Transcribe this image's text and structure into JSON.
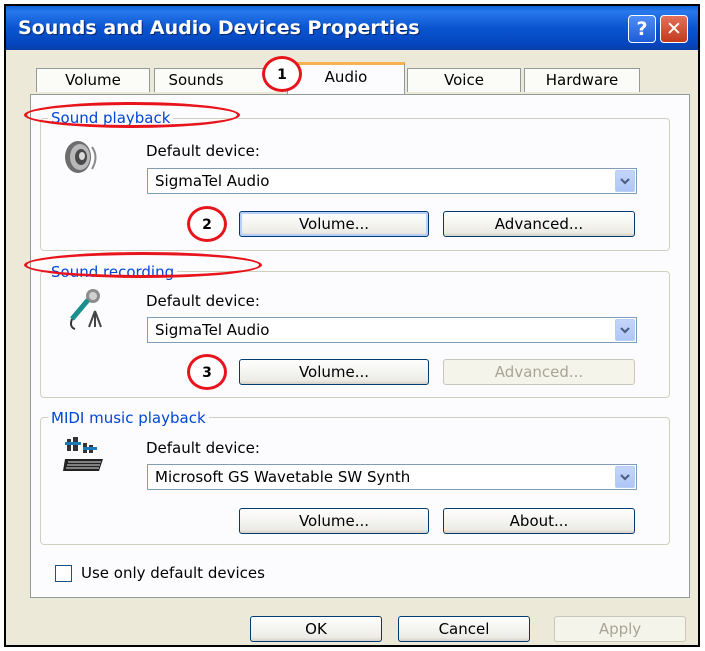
{
  "window": {
    "title": "Sounds and Audio Devices Properties",
    "help_glyph": "?",
    "close_glyph": "✕"
  },
  "tabs": [
    {
      "label": "Volume"
    },
    {
      "label": "Sounds"
    },
    {
      "label": "Audio",
      "active": true
    },
    {
      "label": "Voice"
    },
    {
      "label": "Hardware"
    }
  ],
  "sound_playback": {
    "title": "Sound playback",
    "default_label": "Default device:",
    "device": "SigmaTel Audio",
    "volume_button": "Volume...",
    "advanced_button": "Advanced..."
  },
  "sound_recording": {
    "title": "Sound recording",
    "default_label": "Default device:",
    "device": "SigmaTel Audio",
    "volume_button": "Volume...",
    "advanced_button": "Advanced..."
  },
  "midi": {
    "title": "MIDI music playback",
    "default_label": "Default device:",
    "device": "Microsoft GS Wavetable SW Synth",
    "volume_button": "Volume...",
    "about_button": "About..."
  },
  "checkbox": {
    "label": "Use only default devices",
    "checked": false
  },
  "footer": {
    "ok": "OK",
    "cancel": "Cancel",
    "apply": "Apply"
  },
  "annotations": {
    "one": "1",
    "two": "2",
    "three": "3"
  },
  "colors": {
    "accent_red": "#e8141c",
    "title_blue": "#0a55d0",
    "group_title": "#0046d5"
  }
}
